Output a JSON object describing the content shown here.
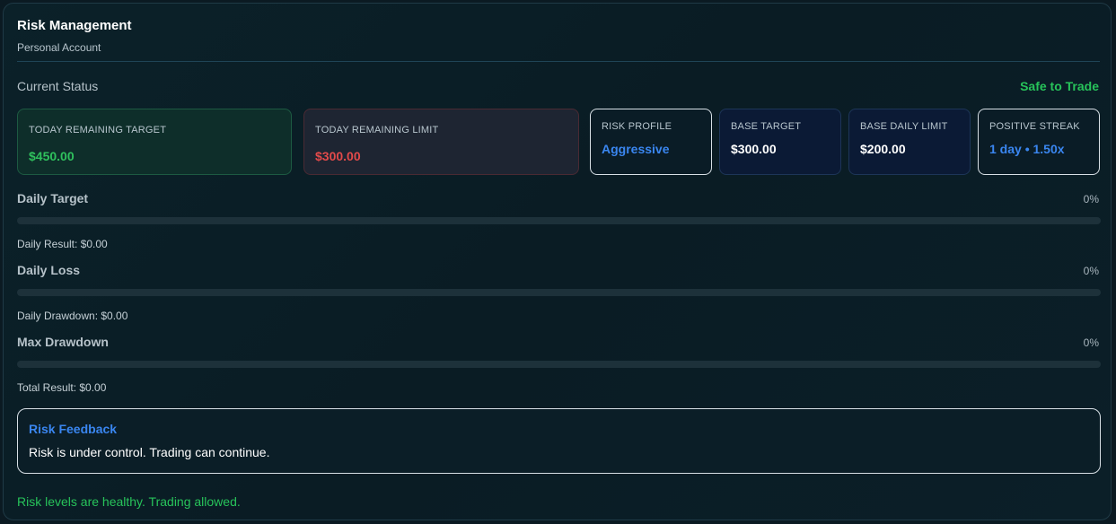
{
  "header": {
    "title": "Risk Management",
    "subtitle": "Personal Account"
  },
  "status": {
    "label": "Current Status",
    "value": "Safe to Trade"
  },
  "cards": {
    "today_target": {
      "label": "TODAY REMAINING TARGET",
      "value": "$450.00"
    },
    "today_limit": {
      "label": "TODAY REMAINING LIMIT",
      "value": "$300.00"
    },
    "risk_profile": {
      "label": "RISK PROFILE",
      "value": "Aggressive"
    },
    "base_target": {
      "label": "BASE TARGET",
      "value": "$300.00"
    },
    "base_daily_limit": {
      "label": "BASE DAILY LIMIT",
      "value": "$200.00"
    },
    "positive_streak": {
      "label": "POSITIVE STREAK",
      "value": "1 day • 1.50x"
    }
  },
  "metrics": [
    {
      "title": "Daily Target",
      "percent_label": "0%",
      "progress": 0,
      "sub": "Daily Result: $0.00"
    },
    {
      "title": "Daily Loss",
      "percent_label": "0%",
      "progress": 0,
      "sub": "Daily Drawdown: $0.00"
    },
    {
      "title": "Max Drawdown",
      "percent_label": "0%",
      "progress": 0,
      "sub": "Total Result: $0.00"
    }
  ],
  "feedback": {
    "title": "Risk Feedback",
    "text": "Risk is under control. Trading can continue."
  },
  "footer": {
    "text": "Risk levels are healthy. Trading allowed."
  },
  "colors": {
    "safe": "#27c35a",
    "danger": "#e34a4a",
    "accent": "#3a86f0"
  }
}
